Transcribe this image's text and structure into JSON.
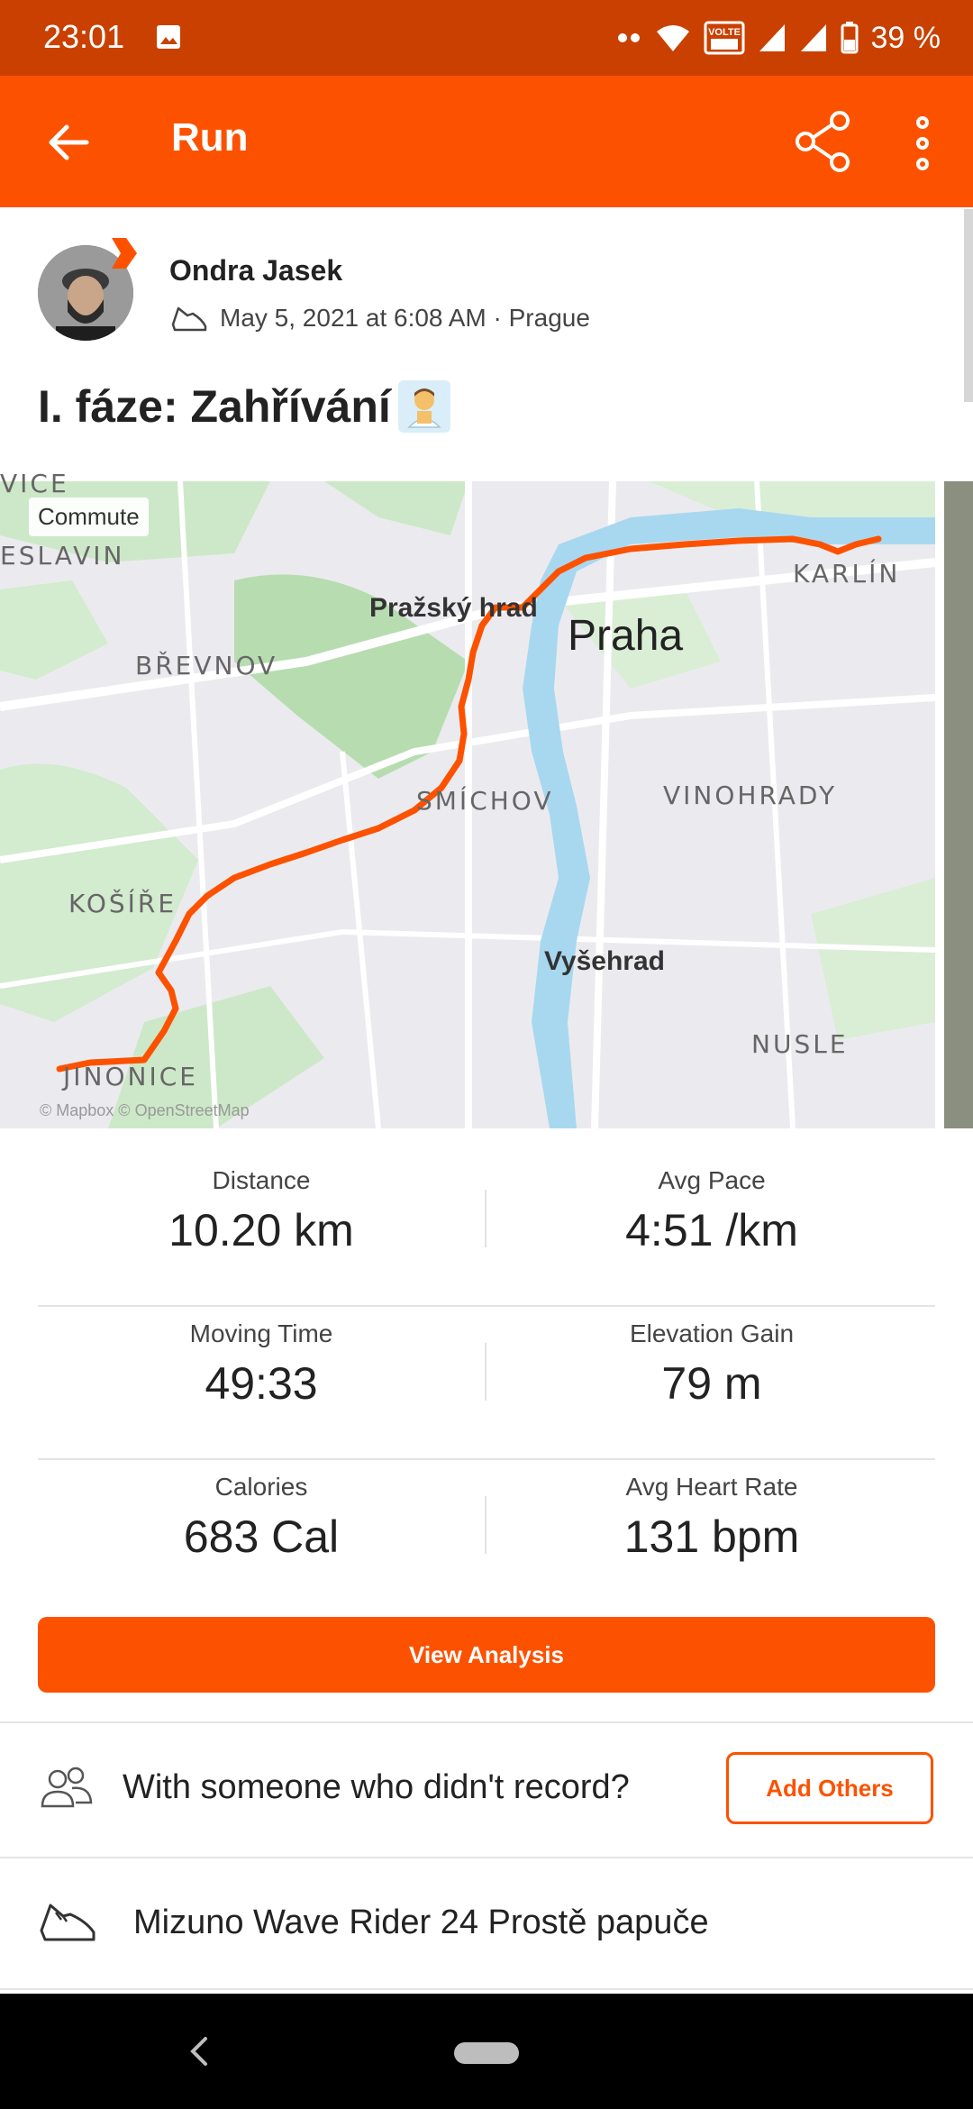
{
  "status_bar": {
    "time": "23:01",
    "battery": "39 %",
    "volte": "VOLTE",
    "icons": [
      "image-icon",
      "dots-icon",
      "wifi-icon",
      "volte-icon",
      "signal-icon",
      "signal-icon",
      "battery-icon"
    ]
  },
  "app_bar": {
    "title": "Run",
    "icons": [
      "back-arrow-icon",
      "share-icon",
      "more-vert-icon"
    ]
  },
  "athlete": {
    "name": "Ondra Jasek",
    "date_location": "May 5, 2021 at 6:08 AM · Prague"
  },
  "activity": {
    "title": "I. fáze: Zahřívání",
    "emoji": "🧖‍♂️"
  },
  "map": {
    "tag": "Commute",
    "labels": [
      "VICE",
      "ESLAVIN",
      "Pražský hrad",
      "Praha",
      "KARLÍN",
      "BŘEVNOV",
      "SMÍCHOV",
      "VINOHRADY",
      "KOŠÍŘE",
      "Vyšehrad",
      "NUSLE",
      "JINONICE"
    ],
    "attribution": "© Mapbox © OpenStreetMap",
    "route_color": "#fc5200",
    "river_color": "#a8d8f0"
  },
  "stats": [
    {
      "label": "Distance",
      "value": "10.20 km"
    },
    {
      "label": "Avg Pace",
      "value": "4:51 /km"
    },
    {
      "label": "Moving Time",
      "value": "49:33"
    },
    {
      "label": "Elevation Gain",
      "value": "79 m"
    },
    {
      "label": "Calories",
      "value": "683 Cal"
    },
    {
      "label": "Avg Heart Rate",
      "value": "131 bpm"
    }
  ],
  "buttons": {
    "view_analysis": "View Analysis",
    "add_others": "Add Others"
  },
  "with_others": {
    "text": "With someone who didn't record?"
  },
  "gear": {
    "text": "Mizuno Wave Rider 24 Prostě papuče"
  },
  "colors": {
    "brand": "#fc5200",
    "status_bar": "#c94000"
  }
}
